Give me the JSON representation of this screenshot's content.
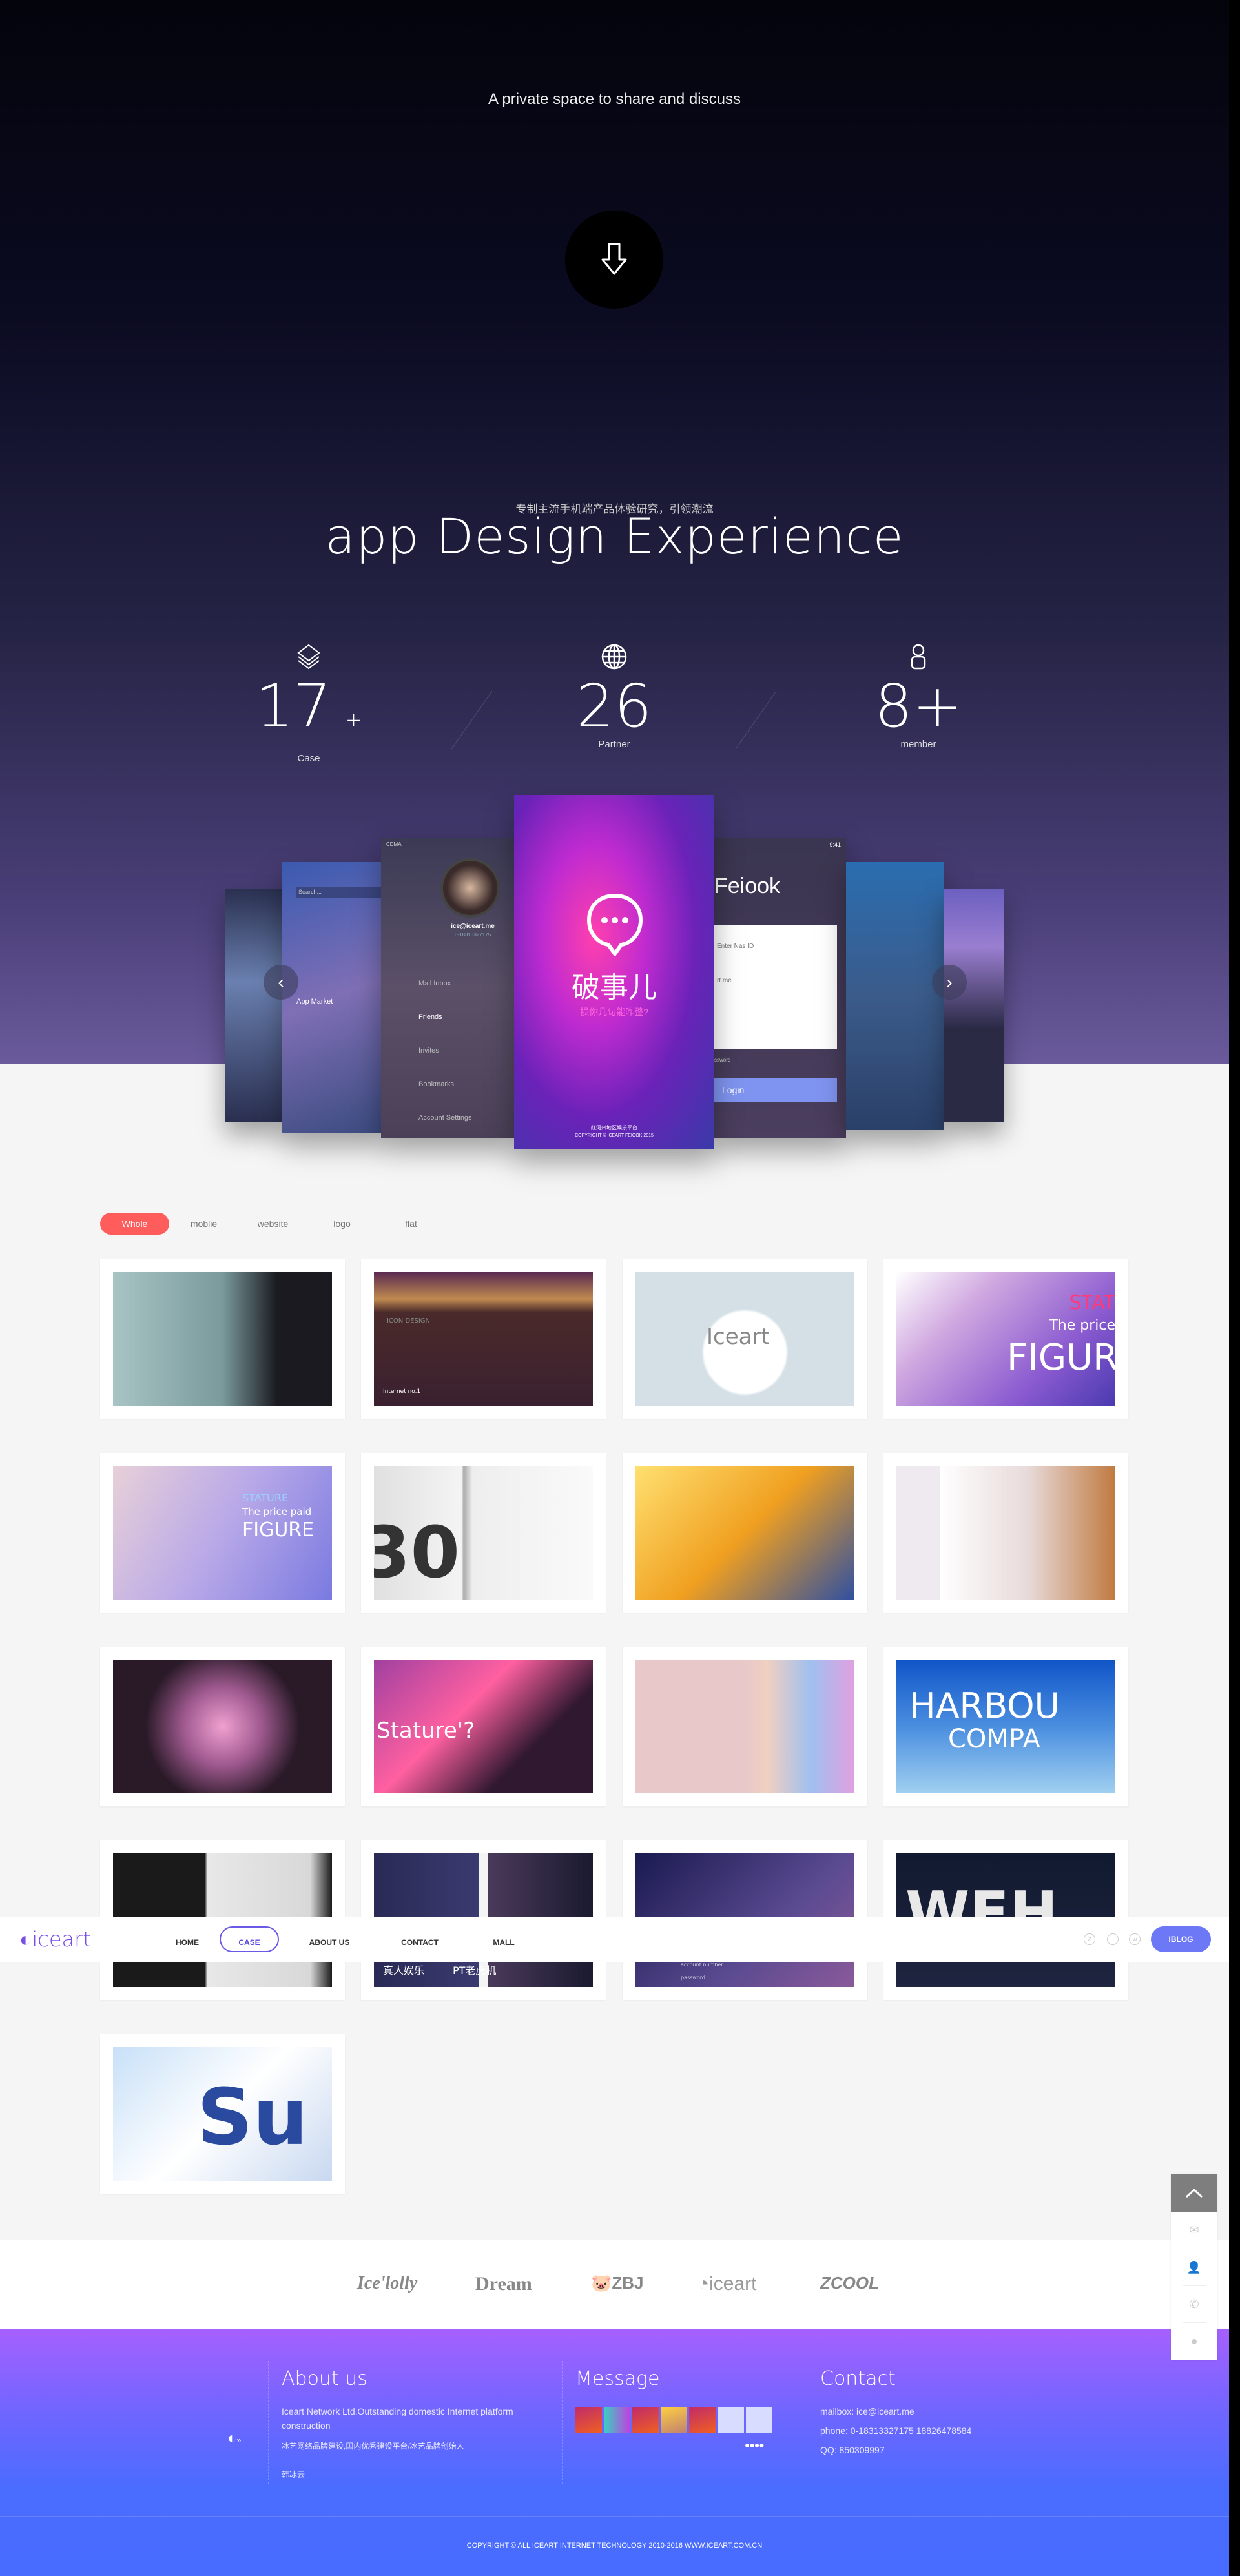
{
  "hero": {
    "tagline": "A private space to share and discuss",
    "down_icon": "arrow-down-icon",
    "subtitle": "专制主流手机端产品体验研究，引领潮流",
    "title": "app Design Experience",
    "stats": [
      {
        "icon": "layers-icon",
        "value": "17",
        "suffix": "+",
        "label": "Case"
      },
      {
        "icon": "globe-icon",
        "value": "26",
        "suffix": "",
        "label": "Partner"
      },
      {
        "icon": "user-icon",
        "value": "8+",
        "suffix": "",
        "label": "member"
      }
    ],
    "phones": {
      "menu": {
        "status": "CDMA",
        "email": "ice@iceart.me",
        "phone": "0-18313327175",
        "items": [
          "Mail Inbox",
          "Friends",
          "Invites",
          "Bookmarks",
          "Account Settings"
        ]
      },
      "center": {
        "app_name": "破事儿",
        "slogan": "损你几句能咋整?",
        "footer1": "红河州地区娱乐平台",
        "footer2": "COPYRIGHT © ICEART FEIOOK 2015"
      },
      "login": {
        "time": "9:41",
        "title": "Feiook",
        "field1": "Enter Nas ID",
        "field2": "rt.me",
        "password_label": "ssword",
        "button": "Login"
      },
      "market": {
        "title": "App Market",
        "search": "Search..."
      }
    },
    "carousel": {
      "prev_icon": "chevron-left-icon",
      "next_icon": "chevron-right-icon"
    }
  },
  "filters": [
    {
      "label": "Whole",
      "active": true
    },
    {
      "label": "moblie"
    },
    {
      "label": "website"
    },
    {
      "label": "logo"
    },
    {
      "label": "flat"
    }
  ],
  "cases": [
    {
      "text": ""
    },
    {
      "text": "ICON DESIGN",
      "sub": "Internet no.1"
    },
    {
      "text": "Iceart"
    },
    {
      "text": "The price",
      "big": "FIGUR",
      "accent": "STAT"
    },
    {
      "text": "The price paid",
      "big": "FIGURE",
      "accent": "STATURE"
    },
    {
      "text": "30"
    },
    {
      "text": ""
    },
    {
      "text": ""
    },
    {
      "text": ""
    },
    {
      "text": "Stature'?"
    },
    {
      "text": ""
    },
    {
      "text": "HARBOU",
      "sub": "COMPA"
    },
    {
      "text": ""
    },
    {
      "text": "真人娱乐",
      "sub": "PT老虎机"
    },
    {
      "text": "account number",
      "sub": "password"
    },
    {
      "text": "WEH"
    },
    {
      "text": "Su"
    }
  ],
  "nav": {
    "logo": "iceart",
    "items": [
      {
        "label": "HOME"
      },
      {
        "label": "CASE",
        "active": true
      },
      {
        "label": "ABOUT US"
      },
      {
        "label": "CONTACT"
      },
      {
        "label": "MALL"
      }
    ],
    "social_icons": [
      "zcool-icon",
      "more-icon",
      "weibo-icon"
    ],
    "blog": "IBLOG"
  },
  "partners": [
    "Ice'lolly",
    "Dream",
    "ZBJ",
    "iceart",
    "ZCOOL"
  ],
  "side_tools": [
    "arrow-up-icon",
    "mail-icon",
    "users-icon",
    "phone-icon",
    "qq-icon"
  ],
  "footer": {
    "about": {
      "title": "About us",
      "line1": "Iceart Network Ltd.Outstanding domestic Internet platform construction",
      "line2": "冰艺网络品牌建设,国内优秀建设平台/冰艺品牌创始人",
      "name": "韩冰云"
    },
    "message": {
      "title": "Message"
    },
    "contact": {
      "title": "Contact",
      "mailbox": "mailbox: ice@iceart.me",
      "phone": "phone: 0-18313327175 18826478584",
      "qq": "QQ: 850309997"
    },
    "copyright": "COPYRIGHT © ALL ICEART INTERNET TECHNOLOGY 2010-2016 WWW.ICEART.COM.CN"
  },
  "colors": {
    "accent": "#ff5c5c",
    "nav_active": "#6a5ae6",
    "blog": "#6c78f5",
    "footer_top": "#a660ff",
    "footer_bottom": "#486cff"
  }
}
